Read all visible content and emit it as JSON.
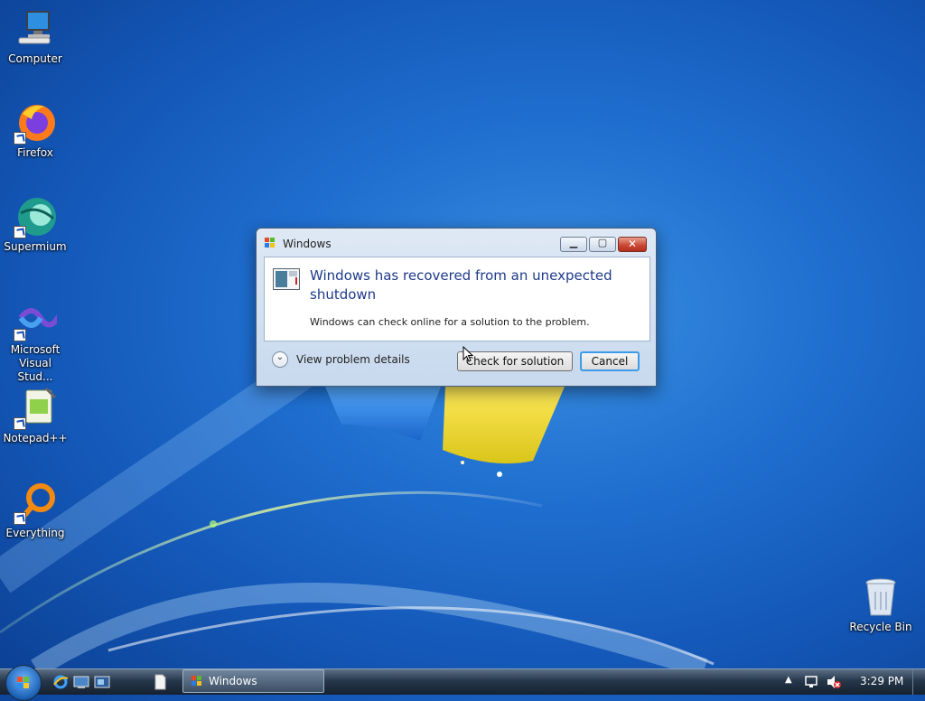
{
  "desktop": {
    "icons": [
      {
        "label": "Computer"
      },
      {
        "label": "Firefox"
      },
      {
        "label": "Supermium"
      },
      {
        "label": "Microsoft Visual Stud..."
      },
      {
        "label": "Notepad++"
      },
      {
        "label": "Everything"
      },
      {
        "label": "Recycle Bin"
      }
    ]
  },
  "dialog": {
    "title": "Windows",
    "headline": "Windows has recovered from an unexpected shutdown",
    "subtext": "Windows can check online for a solution to the problem.",
    "details_label": "View problem details",
    "check_button": "Check for solution",
    "cancel_button": "Cancel"
  },
  "taskbar": {
    "window_button": "Windows",
    "clock": "3:29 PM"
  }
}
